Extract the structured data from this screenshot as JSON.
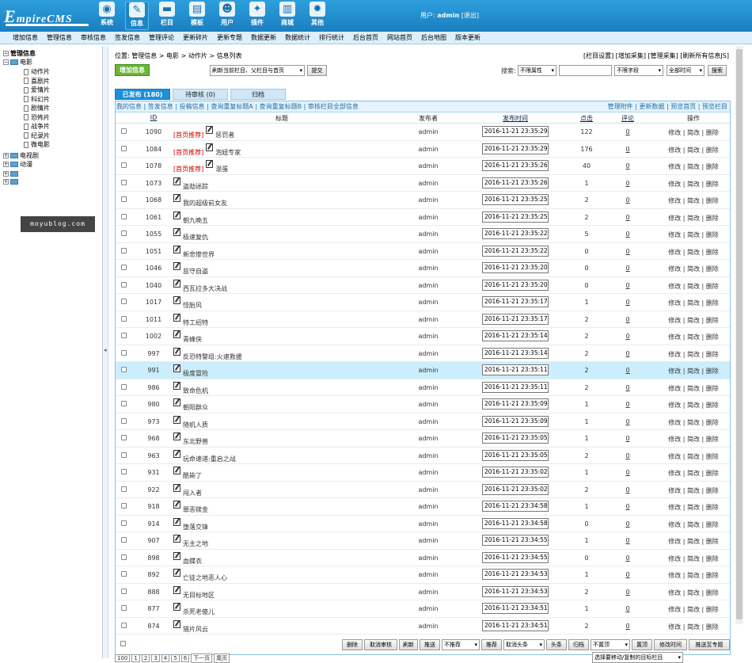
{
  "app": {
    "logo_main": "E",
    "logo_rest": "mpireCMS",
    "user_label": "用户:",
    "user_name": "admin",
    "logout": "[退出]"
  },
  "nav": [
    "系统",
    "信息",
    "栏目",
    "模板",
    "用户",
    "插件",
    "商城",
    "其他"
  ],
  "nav_icons": [
    "globe-icon",
    "info-icon",
    "folder-icon",
    "template-icon",
    "user-icon",
    "plugin-icon",
    "shop-icon",
    "gear-icon"
  ],
  "subnav": [
    "增加信息",
    "管理信息",
    "审核信息",
    "签发信息",
    "管理评论",
    "更新碎片",
    "更新专题",
    "数据更新",
    "数据统计",
    "排行统计",
    "后台首页",
    "网站首页",
    "后台地图",
    "版本更新"
  ],
  "sidebar": {
    "title": "管理信息",
    "root": "电影",
    "children": [
      "动作片",
      "喜剧片",
      "爱情片",
      "科幻片",
      "剧情片",
      "恐怖片",
      "战争片",
      "纪录片",
      "微电影"
    ],
    "others": [
      "电视剧",
      "动漫"
    ],
    "watermark": "moyublog.com"
  },
  "breadcrumb": "位置: 管理信息 > 电影 > 动作片 > 信息列表",
  "right_links": "[栏目设置] [增加采集] [管理采集] [刷新所有信息JS]",
  "add_button": "增加信息",
  "refresh_select": "刷新当前栏目、父栏目与首页",
  "submit": "提交",
  "search": {
    "label": "搜索:",
    "attr": "不限属性",
    "field": "不限字段",
    "time": "全部时间",
    "button": "搜索",
    "value": ""
  },
  "tabs": [
    "已发布 (180)",
    "待审核 (0)",
    "归档"
  ],
  "subbar_left": "我的信息 | 签发信息 | 投稿信息 | 查询重复标题A | 查询重复标题B | 审核栏目全部信息",
  "subbar_right": "管理附件 | 更新数据 | 预览首页 | 预览栏目",
  "headers": {
    "id": "ID",
    "title": "标题",
    "publisher": "发布者",
    "time": "发布时间",
    "clicks": "点击",
    "comments": "评论",
    "ops": "操作"
  },
  "rec_label": "[首页推荐]",
  "ops_text": "修改 | 简改 | 删除",
  "rows": [
    {
      "id": "1090",
      "title": "惩罚者",
      "rec": true,
      "pub": "admin",
      "time": "2016-11-21 23:35:29",
      "clicks": "122",
      "cmt": "0"
    },
    {
      "id": "1084",
      "title": "泡妞专家",
      "rec": true,
      "pub": "admin",
      "time": "2016-11-21 23:35:29",
      "clicks": "176",
      "cmt": "0"
    },
    {
      "id": "1078",
      "title": "混蛋",
      "rec": true,
      "pub": "admin",
      "time": "2016-11-21 23:35:26",
      "clicks": "40",
      "cmt": "0"
    },
    {
      "id": "1073",
      "title": "盗劫迷踪",
      "rec": false,
      "pub": "admin",
      "time": "2016-11-21 23:35:26",
      "clicks": "1",
      "cmt": "0"
    },
    {
      "id": "1068",
      "title": "我的超级前女友",
      "rec": false,
      "pub": "admin",
      "time": "2016-11-21 23:35:25",
      "clicks": "2",
      "cmt": "0"
    },
    {
      "id": "1061",
      "title": "朝九晚五",
      "rec": false,
      "pub": "admin",
      "time": "2016-11-21 23:35:25",
      "clicks": "2",
      "cmt": "0"
    },
    {
      "id": "1055",
      "title": "极速复仇",
      "rec": false,
      "pub": "admin",
      "time": "2016-11-21 23:35:22",
      "clicks": "5",
      "cmt": "0"
    },
    {
      "id": "1051",
      "title": "新悲惨世界",
      "rec": false,
      "pub": "admin",
      "time": "2016-11-21 23:35:22",
      "clicks": "0",
      "cmt": "0"
    },
    {
      "id": "1046",
      "title": "监守自盗",
      "rec": false,
      "pub": "admin",
      "time": "2016-11-21 23:35:20",
      "clicks": "0",
      "cmt": "0"
    },
    {
      "id": "1040",
      "title": "西瓦拉多大决战",
      "rec": false,
      "pub": "admin",
      "time": "2016-11-21 23:35:20",
      "clicks": "0",
      "cmt": "0"
    },
    {
      "id": "1017",
      "title": "怪胎风",
      "rec": false,
      "pub": "admin",
      "time": "2016-11-21 23:35:17",
      "clicks": "1",
      "cmt": "0"
    },
    {
      "id": "1011",
      "title": "特工绍特",
      "rec": false,
      "pub": "admin",
      "time": "2016-11-21 23:35:17",
      "clicks": "2",
      "cmt": "0"
    },
    {
      "id": "1002",
      "title": "青蜂侠",
      "rec": false,
      "pub": "admin",
      "time": "2016-11-21 23:35:14",
      "clicks": "2",
      "cmt": "0"
    },
    {
      "id": "997",
      "title": "反恐特警组:火速救援",
      "rec": false,
      "pub": "admin",
      "time": "2016-11-21 23:35:14",
      "clicks": "2",
      "cmt": "0"
    },
    {
      "id": "991",
      "title": "极度冒险",
      "rec": false,
      "pub": "admin",
      "time": "2016-11-21 23:35:11",
      "clicks": "2",
      "cmt": "0",
      "hl": true
    },
    {
      "id": "986",
      "title": "致命危机",
      "rec": false,
      "pub": "admin",
      "time": "2016-11-21 23:35:11",
      "clicks": "2",
      "cmt": "0"
    },
    {
      "id": "980",
      "title": "朝阳群众",
      "rec": false,
      "pub": "admin",
      "time": "2016-11-21 23:35:09",
      "clicks": "1",
      "cmt": "0"
    },
    {
      "id": "973",
      "title": "随机人质",
      "rec": false,
      "pub": "admin",
      "time": "2016-11-21 23:35:09",
      "clicks": "1",
      "cmt": "0"
    },
    {
      "id": "968",
      "title": "东北野兽",
      "rec": false,
      "pub": "admin",
      "time": "2016-11-21 23:35:05",
      "clicks": "1",
      "cmt": "0"
    },
    {
      "id": "963",
      "title": "玩命速递:重启之战",
      "rec": false,
      "pub": "admin",
      "time": "2016-11-21 23:35:05",
      "clicks": "2",
      "cmt": "0"
    },
    {
      "id": "931",
      "title": "酷毙了",
      "rec": false,
      "pub": "admin",
      "time": "2016-11-21 23:35:02",
      "clicks": "1",
      "cmt": "0"
    },
    {
      "id": "922",
      "title": "闯入者",
      "rec": false,
      "pub": "admin",
      "time": "2016-11-21 23:35:02",
      "clicks": "2",
      "cmt": "0"
    },
    {
      "id": "918",
      "title": "罪恶赎金",
      "rec": false,
      "pub": "admin",
      "time": "2016-11-21 23:34:58",
      "clicks": "1",
      "cmt": "0"
    },
    {
      "id": "914",
      "title": "堕落交锋",
      "rec": false,
      "pub": "admin",
      "time": "2016-11-21 23:34:58",
      "clicks": "0",
      "cmt": "0"
    },
    {
      "id": "907",
      "title": "无主之地",
      "rec": false,
      "pub": "admin",
      "time": "2016-11-21 23:34:55",
      "clicks": "1",
      "cmt": "0"
    },
    {
      "id": "898",
      "title": "血蝶衣",
      "rec": false,
      "pub": "admin",
      "time": "2016-11-21 23:34:55",
      "clicks": "0",
      "cmt": "0"
    },
    {
      "id": "892",
      "title": "亡徒之地恶人心",
      "rec": false,
      "pub": "admin",
      "time": "2016-11-21 23:34:53",
      "clicks": "1",
      "cmt": "0"
    },
    {
      "id": "888",
      "title": "无目标地区",
      "rec": false,
      "pub": "admin",
      "time": "2016-11-21 23:34:53",
      "clicks": "2",
      "cmt": "0"
    },
    {
      "id": "877",
      "title": "杀死老傻儿",
      "rec": false,
      "pub": "admin",
      "time": "2016-11-21 23:34:51",
      "clicks": "1",
      "cmt": "0"
    },
    {
      "id": "874",
      "title": "猎片风云",
      "rec": false,
      "pub": "admin",
      "time": "2016-11-21 23:34:51",
      "clicks": "2",
      "cmt": "0"
    }
  ],
  "bottom": {
    "delete": "删除",
    "unaudit": "取消审核",
    "refresh": "刷新",
    "push": "推送",
    "norec": "不推荐",
    "rec": "推荐",
    "unhead": "取消头条",
    "head": "头条",
    "archive": "归档",
    "notop": "不置顶",
    "top": "置顶",
    "modtime": "修改时间",
    "pushtopic": "推送至专题"
  },
  "pager": [
    "100",
    "1",
    "2",
    "3",
    "4",
    "5",
    "6",
    "下一页",
    "尾页"
  ],
  "bottom_right": "选择要移动/复制的目标栏目"
}
